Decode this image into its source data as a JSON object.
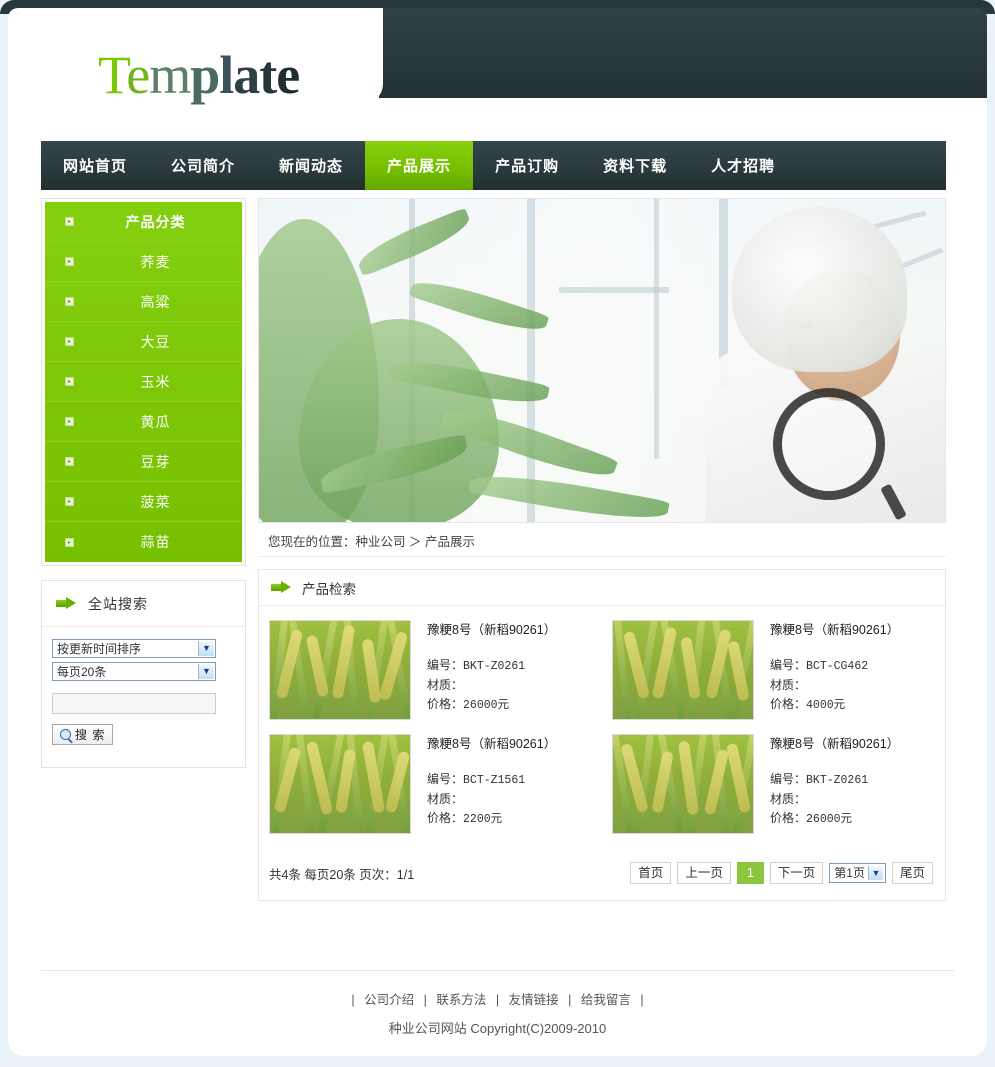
{
  "site": {
    "logo_text": "Template",
    "logo_letters": [
      "T",
      "e",
      "m",
      "p",
      "l",
      "a",
      "t",
      "e"
    ]
  },
  "nav": {
    "items": [
      {
        "label": "网站首页",
        "active": false
      },
      {
        "label": "公司简介",
        "active": false
      },
      {
        "label": "新闻动态",
        "active": false
      },
      {
        "label": "产品展示",
        "active": true
      },
      {
        "label": "产品订购",
        "active": false
      },
      {
        "label": "资料下载",
        "active": false
      },
      {
        "label": "人才招聘",
        "active": false
      }
    ]
  },
  "sidebar": {
    "categories": {
      "title": "产品分类",
      "items": [
        "荞麦",
        "高粱",
        "大豆",
        "玉米",
        "黄瓜",
        "豆芽",
        "菠菜",
        "蒜苗"
      ]
    },
    "search": {
      "title": "全站搜索",
      "sort_select": "按更新时间排序",
      "perpage_select": "每页20条",
      "keyword_value": "",
      "keyword_placeholder": "",
      "button_label": "搜 索",
      "arrow_icon": "arrow-right-icon",
      "magnifier_icon": "magnifier-icon"
    }
  },
  "main": {
    "banner_alt": "温室中手持放大镜检查植株的研究人员",
    "breadcrumb": "您现在的位置：种业公司 ＞ 产品展示",
    "panel_title": "产品检索",
    "panel_arrow_icon": "arrow-right-icon",
    "products": [
      {
        "title": "豫粳8号（新稻90261）",
        "code_label": "编号：",
        "code": "BKT-Z0261",
        "material_label": "材质：",
        "material": "",
        "price_label": "价格：",
        "price": "26000元",
        "thumb_alt": "水稻田照片"
      },
      {
        "title": "豫粳8号（新稻90261）",
        "code_label": "编号：",
        "code": "BCT-CG462",
        "material_label": "材质：",
        "material": "",
        "price_label": "价格：",
        "price": "4000元",
        "thumb_alt": "水稻田照片"
      },
      {
        "title": "豫粳8号（新稻90261）",
        "code_label": "编号：",
        "code": "BCT-Z1561",
        "material_label": "材质：",
        "material": "",
        "price_label": "价格：",
        "price": "2200元",
        "thumb_alt": "水稻田照片"
      },
      {
        "title": "豫粳8号（新稻90261）",
        "code_label": "编号：",
        "code": "BKT-Z0261",
        "material_label": "材质：",
        "material": "",
        "price_label": "价格：",
        "price": "26000元",
        "thumb_alt": "水稻田照片"
      }
    ],
    "pager": {
      "summary": "共4条 每页20条 页次：1/1",
      "first": "首页",
      "prev": "上一页",
      "current": "1",
      "next": "下一页",
      "jump_select": "第1页",
      "last": "尾页"
    }
  },
  "footer": {
    "links": [
      "公司介绍",
      "联系方法",
      "友情链接",
      "给我留言"
    ],
    "copyright": "种业公司网站  Copyright(C)2009-2010"
  },
  "colors": {
    "accent_green": "#76c000",
    "dark_header": "#2b3b40",
    "page_bg": "#e9f3f8",
    "pager_current": "#8cc63f"
  }
}
